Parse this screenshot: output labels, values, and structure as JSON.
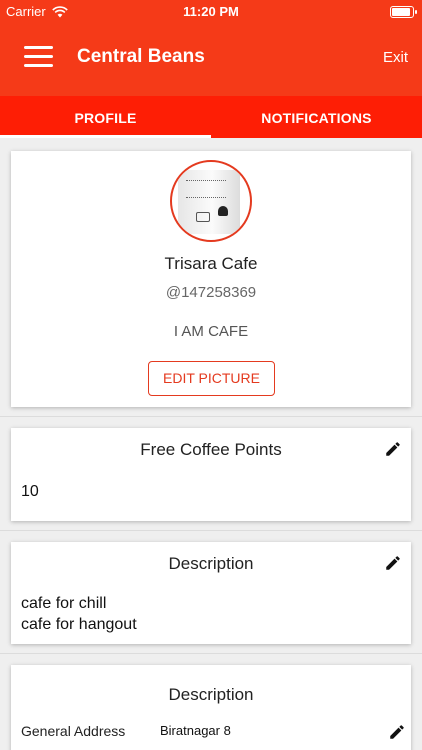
{
  "status_bar": {
    "carrier": "Carrier",
    "time": "11:20 PM",
    "battery_level": 0.95
  },
  "app_bar": {
    "title": "Central Beans",
    "exit_label": "Exit",
    "menu_icon": "hamburger-menu-icon"
  },
  "tabs": [
    {
      "label": "PROFILE",
      "active": true
    },
    {
      "label": "NOTIFICATIONS",
      "active": false
    }
  ],
  "profile": {
    "name": "Trisara Cafe",
    "handle": "@147258369",
    "bio": "I AM CAFE",
    "edit_picture_label": "EDIT PICTURE",
    "accent_color": "#e43a1f"
  },
  "points_card": {
    "title": "Free Coffee Points",
    "value": "10",
    "edit_icon": "pencil-icon"
  },
  "description_card": {
    "title": "Description",
    "lines": [
      "cafe for chill",
      "cafe for hangout"
    ],
    "edit_icon": "pencil-icon"
  },
  "address_card": {
    "title": "Description",
    "label": "General Address",
    "value": "Biratnagar 8",
    "edit_icon": "pencil-icon"
  },
  "colors": {
    "header": "#f53a18",
    "tab_bar": "#fe1e05"
  }
}
